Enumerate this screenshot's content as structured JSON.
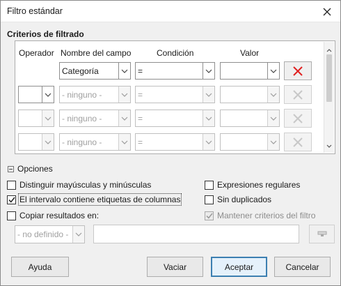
{
  "window": {
    "title": "Filtro estándar"
  },
  "criteria": {
    "section_title": "Criterios de filtrado",
    "headers": {
      "operator": "Operador",
      "field_name": "Nombre del campo",
      "condition": "Condición",
      "value": "Valor"
    },
    "rows": [
      {
        "operator": "",
        "field": "Categoría",
        "condition": "=",
        "value": "",
        "enabled": true
      },
      {
        "operator": "",
        "field": "- ninguno -",
        "condition": "=",
        "value": "",
        "enabled": false
      },
      {
        "operator": "",
        "field": "- ninguno -",
        "condition": "=",
        "value": "",
        "enabled": false
      },
      {
        "operator": "",
        "field": "- ninguno -",
        "condition": "=",
        "value": "",
        "enabled": false
      }
    ]
  },
  "options": {
    "toggle_label": "Opciones",
    "case_sensitive": {
      "label": "Distinguir mayúsculas y minúsculas",
      "checked": false
    },
    "regex": {
      "label": "Expresiones regulares",
      "checked": false
    },
    "has_headers": {
      "label": "El intervalo contiene etiquetas de columnas",
      "checked": true
    },
    "no_duplicates": {
      "label": "Sin duplicados",
      "checked": false
    },
    "copy_results": {
      "label": "Copiar resultados en:",
      "checked": false
    },
    "keep_criteria": {
      "label": "Mantener criterios del filtro",
      "checked": true,
      "enabled": false
    },
    "destination_select": "- no definido -",
    "destination_value": ""
  },
  "buttons": {
    "help": "Ayuda",
    "reset": "Vaciar",
    "ok": "Aceptar",
    "cancel": "Cancelar"
  },
  "colors": {
    "delete_x_active": "#e02020",
    "delete_x_disabled": "#c8c8c8",
    "accent": "#3c7fb1"
  }
}
